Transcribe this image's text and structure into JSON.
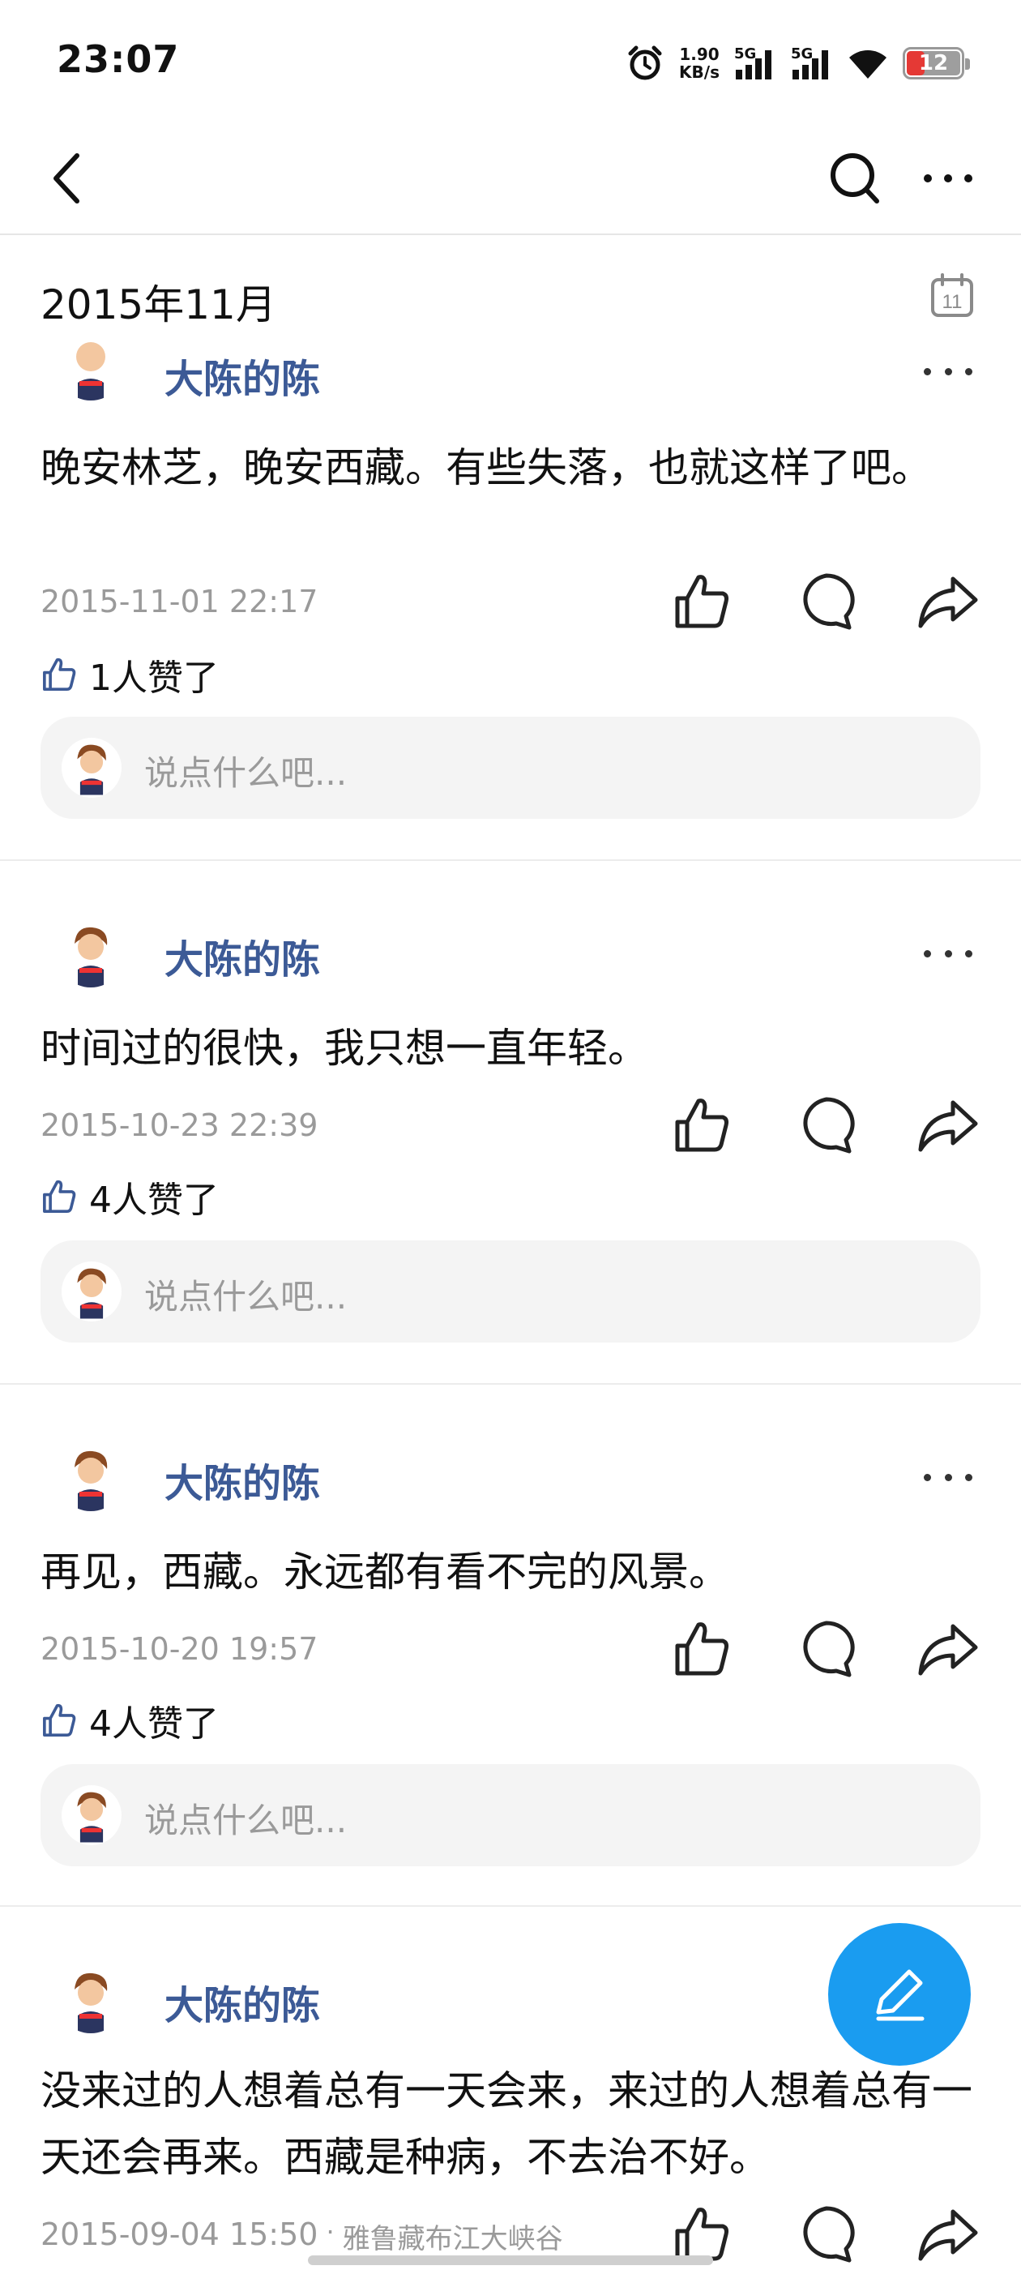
{
  "status_bar": {
    "time": "23:07",
    "net_speed_value": "1.90",
    "net_speed_unit": "KB/s",
    "sim1_label": "5G",
    "sim2_label": "5G",
    "battery_level": "12"
  },
  "nav": {
    "back_icon": "chevron-left-icon",
    "search_icon": "search-icon",
    "more_icon": "more-horizontal-icon"
  },
  "month_header": {
    "title": "2015年11月",
    "calendar_day": "11"
  },
  "posts": [
    {
      "username": "大陈的陈",
      "content": "晚安林芝，晚安西藏。有些失落，也就这样了吧。",
      "timestamp": "2015-11-01 22:17",
      "likes_text": "1人赞了",
      "comment_placeholder": "说点什么吧..."
    },
    {
      "username": "大陈的陈",
      "content": "时间过的很快，我只想一直年轻。",
      "timestamp": "2015-10-23 22:39",
      "likes_text": "4人赞了",
      "comment_placeholder": "说点什么吧..."
    },
    {
      "username": "大陈的陈",
      "content": "再见，西藏。永远都有看不完的风景。",
      "timestamp": "2015-10-20 19:57",
      "likes_text": "4人赞了",
      "comment_placeholder": "说点什么吧..."
    },
    {
      "username": "大陈的陈",
      "content": "没来过的人想着总有一天会来，来过的人想着总有一天还会再来。西藏是种病，不去治不好。",
      "timestamp": "2015-09-04 15:50",
      "location_separator": "·",
      "location": "雅鲁藏布江大峡谷"
    }
  ],
  "fab": {
    "icon": "edit-pencil-icon"
  },
  "colors": {
    "username": "#3c5a96",
    "fab": "#1a9cf0",
    "timestamp": "#9a9a9a",
    "comment_box": "#f4f4f4"
  }
}
